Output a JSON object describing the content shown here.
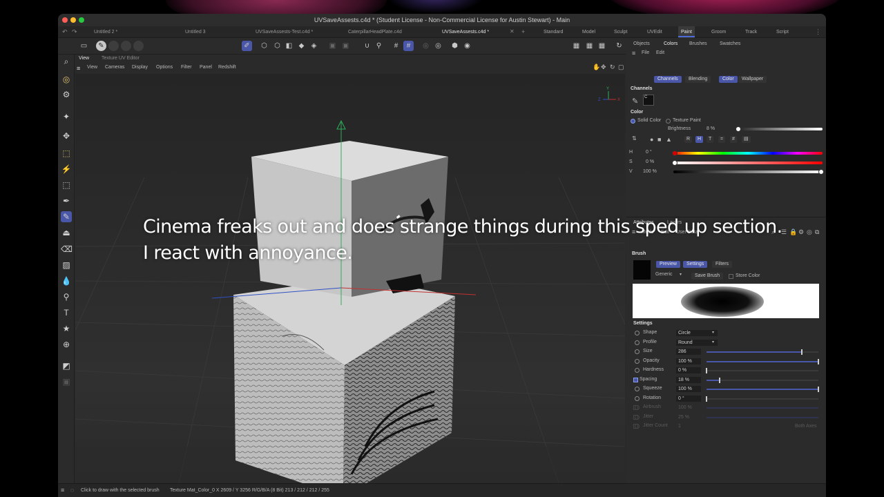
{
  "window": {
    "title": "UVSaveAssests.c4d * (Student License - Non-Commercial License for Austin Stewart) - Main"
  },
  "doc_tabs": [
    {
      "label": "Untitled 2 *",
      "active": false
    },
    {
      "label": "Untitled 3",
      "active": false
    },
    {
      "label": "UVSaveAssests-Test.c4d *",
      "active": false
    },
    {
      "label": "CaterpillarHeadPlate.c4d",
      "active": false
    },
    {
      "label": "UVSaveAssests.c4d *",
      "active": true
    }
  ],
  "layout_tabs": [
    "Standard",
    "Model",
    "Sculpt",
    "UVEdit",
    "Paint",
    "Groom",
    "Track",
    "Script"
  ],
  "active_layout": "Paint",
  "viewport": {
    "tabs": [
      "View",
      "Texture UV Editor"
    ],
    "menu": [
      "View",
      "Cameras",
      "Display",
      "Options",
      "Filter",
      "Panel",
      "Redshift"
    ],
    "axis_labels": {
      "y": "Y",
      "z": "Z",
      "x": "X"
    }
  },
  "right_panel": {
    "top_tabs": [
      "Objects",
      "Colors",
      "Brushes",
      "Swatches"
    ],
    "active_top_tab": "Colors",
    "menu": [
      "File",
      "Edit"
    ],
    "channel_tabs": [
      "Channels",
      "Blending",
      "Color",
      "Wallpaper"
    ],
    "channels_heading": "Channels",
    "channel_label": "C",
    "color_heading": "Color",
    "solid_color": "Solid Color",
    "texture_paint": "Texture Paint",
    "brightness_label": "Brightness",
    "brightness_value": "8 %",
    "mode_buttons": [
      "R",
      "H",
      "T",
      "=",
      "#",
      "▤"
    ],
    "hsv": [
      {
        "label": "H",
        "value": "0 °"
      },
      {
        "label": "S",
        "value": "0 %"
      },
      {
        "label": "V",
        "value": "100 %"
      }
    ],
    "attr_tabs": [
      "Attributes",
      "Layers"
    ],
    "attr_menu": [
      "Mode",
      "Edit",
      "User Data"
    ],
    "brush_heading": "Brush",
    "brush_tabs": [
      "Preview",
      "Settings",
      "Filters"
    ],
    "brush_preset": "Generic",
    "save_brush": "Save Brush",
    "store_color": "Store Color",
    "settings_heading": "Settings",
    "settings": [
      {
        "label": "Shape",
        "value": "Circle",
        "type": "dropdown"
      },
      {
        "label": "Profile",
        "value": "Round",
        "type": "dropdown"
      },
      {
        "label": "Size",
        "value": "286",
        "type": "slider",
        "level": 0.85
      },
      {
        "label": "Opacity",
        "value": "100 %",
        "type": "slider",
        "level": 1.0
      },
      {
        "label": "Hardness",
        "value": "0 %",
        "type": "slider",
        "level": 0.0
      },
      {
        "label": "Spacing",
        "value": "18 %",
        "type": "slider",
        "level": 0.12,
        "checkbox": true
      },
      {
        "label": "Squeeze",
        "value": "100 %",
        "type": "slider",
        "level": 1.0
      },
      {
        "label": "Rotation",
        "value": "0 °",
        "type": "slider",
        "level": 0.0
      },
      {
        "label": "Airbrush",
        "value": "100 %",
        "type": "slider",
        "level": 0.5,
        "disabled": true
      },
      {
        "label": "Jitter",
        "value": "25 %",
        "type": "slider",
        "level": 0.0,
        "disabled": true
      },
      {
        "label": "Jitter Count",
        "value": "1",
        "type": "text",
        "disabled": true
      }
    ],
    "both_axes": "Both Axes"
  },
  "status": {
    "message": "Click to draw with the selected brush",
    "info": "Texture Mat_Color_0   X 2609 / Y 3256 R/G/B/A (8 Bit) 213 / 212 / 212 / 255"
  },
  "subtitle": {
    "line1": "Cinema freaks out and does strange things during this sped up section.",
    "line2": "I react with annoyance."
  },
  "colors": {
    "accent": "#4a57a8",
    "close": "#ff5f57",
    "minimize": "#febc2e",
    "zoom": "#28c840"
  }
}
